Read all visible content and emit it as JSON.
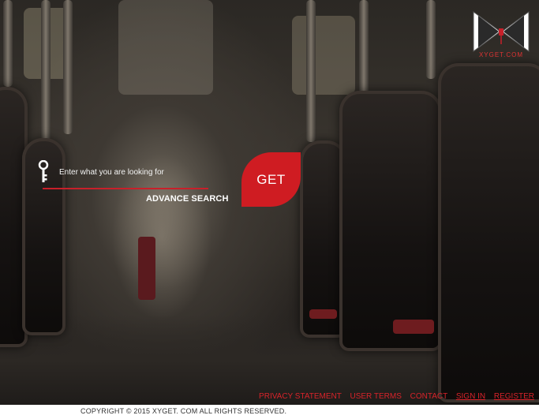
{
  "logo": {
    "text": "XYGET.COM",
    "icon": "bowtie-logo-icon"
  },
  "search": {
    "placeholder": "Enter what you are looking for",
    "icon": "key-icon",
    "value": ""
  },
  "advance_search": "ADVANCE SEARCH",
  "get_button": "GET",
  "footer_links": [
    "PRIVACY STATEMENT",
    "USER TERMS",
    "CONTACT",
    "SIGN IN",
    "REGISTER"
  ],
  "copyright": "COPYRIGHT © 2015 XYGET. COM ALL RIGHTS RESERVED.",
  "colors": {
    "accent": "#cf1c22",
    "link": "#d8232a",
    "footer_bg": "#ffffff"
  }
}
